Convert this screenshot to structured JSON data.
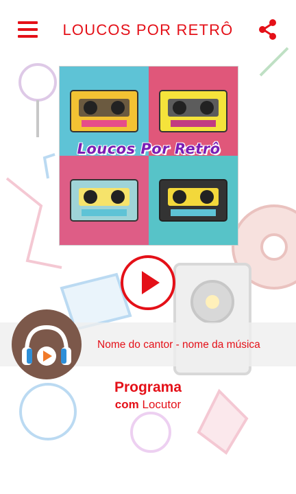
{
  "header": {
    "title": "LOUCOS POR RETRÔ"
  },
  "cover": {
    "logo_text": "Loucos Por Retrô"
  },
  "player": {
    "track_info": "Nome do cantor - nome da música"
  },
  "program": {
    "name": "Programa",
    "host_prefix": "com",
    "host": "Locutor"
  },
  "colors": {
    "accent": "#e41018",
    "avatar_bg": "#7c584a",
    "headphone_blue": "#2e8fd8",
    "play_orange": "#f07a2a"
  },
  "icons": [
    "menu-icon",
    "share-icon",
    "play-icon",
    "headphones-icon"
  ]
}
